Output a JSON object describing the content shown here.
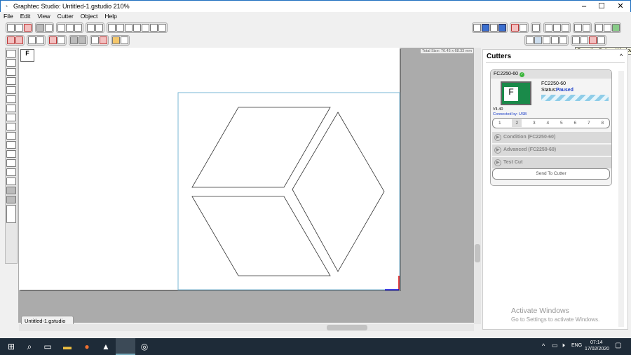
{
  "window": {
    "title": "Graphtec Studio: Untitled-1.gstudio 210%",
    "minimize": "–",
    "maximize": "☐",
    "close": "✕"
  },
  "menu": [
    "File",
    "Edit",
    "View",
    "Cutter",
    "Object",
    "Help"
  ],
  "canvas": {
    "size_info": "Total Size: 76.45 x 68.33 mm",
    "doc_tab": "Untitled-1.gstudio",
    "doc_tab_close": "✖"
  },
  "tooltip": "Open the Cutters Window",
  "cutters": {
    "title": "Cutters",
    "collapse": "^",
    "device": "FC2250-60",
    "model": "FC2250-60",
    "status_label": "Status:",
    "status": "Paused",
    "status_color": "#1a3dc8",
    "version": "V4.40",
    "connection": "Connected by: USB",
    "tabs": [
      "1",
      "2",
      "3",
      "4",
      "5",
      "6",
      "7",
      "8"
    ],
    "selected_tab": "2",
    "sections": [
      "Condition (FC2250-60)",
      "Advanced (FC2250-60)",
      "Test Cut"
    ],
    "send": "Send To Cutter"
  },
  "activation": {
    "title": "Activate Windows",
    "subtitle": "Go to Settings to activate Windows."
  },
  "taskbar": {
    "language": "ENG",
    "time": "07:14",
    "date": "17/02/2020"
  }
}
